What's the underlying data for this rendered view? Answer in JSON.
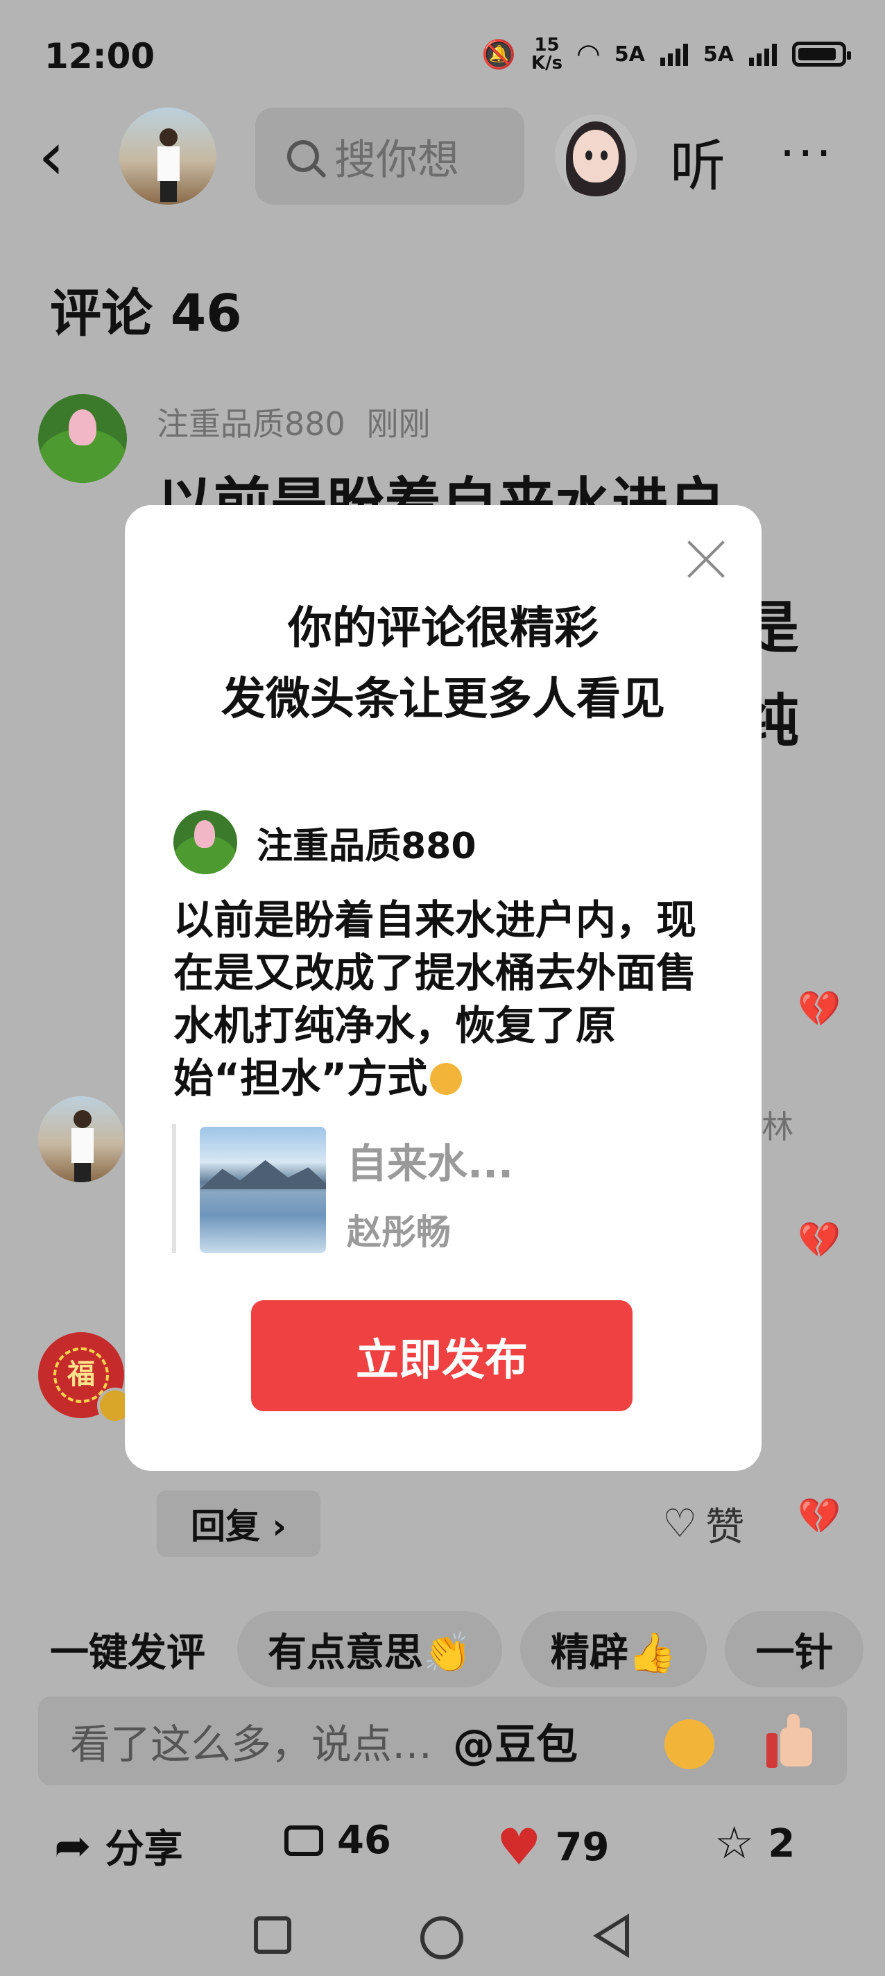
{
  "status_bar": {
    "time": "12:00",
    "speed_value": "15",
    "speed_unit": "K/s",
    "net1": "5A",
    "net2": "5A"
  },
  "header": {
    "search_placeholder": "搜你想",
    "listen_label": "听",
    "more_label": "···"
  },
  "comments": {
    "title": "评论 46",
    "first": {
      "author": "注重品质880",
      "time": "刚刚",
      "text": "以前是盼着自来水进户",
      "frag_line2": "是",
      "frag_line3": "纯"
    },
    "second": {
      "name_fragment": "林"
    },
    "reply_label": "回复 ›",
    "like_label": "赞"
  },
  "quick_comments": {
    "label": "一键发评",
    "chips": [
      "有点意思👏",
      "精辟👍",
      "一针"
    ]
  },
  "input": {
    "placeholder": "看了这么多，说点…",
    "mention": "@豆包"
  },
  "actions": {
    "share": "分享",
    "comments_count": "46",
    "likes_count": "79",
    "favorites_count": "2"
  },
  "modal": {
    "title_line1": "你的评论很精彩",
    "title_line2": "发微头条让更多人看见",
    "author": "注重品质880",
    "body": "以前是盼着自来水进户内，现在是又改成了提水桶去外面售水机打纯净水，恢复了原始“担水”方式",
    "quote_title": "自来水...",
    "quote_author": "赵彤畅",
    "publish_label": "立即发布"
  },
  "colors": {
    "accent": "#f04142",
    "heart": "#d42b2b",
    "overlay": "#b4b4b4"
  }
}
